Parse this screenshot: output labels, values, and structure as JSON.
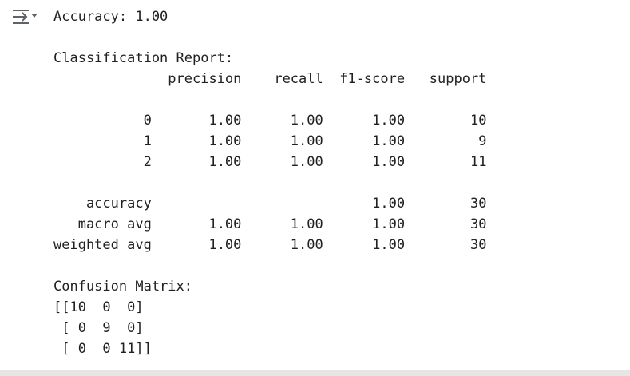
{
  "output": {
    "icon": "collapse-output-icon",
    "lines": [
      "Accuracy: 1.00",
      "",
      "Classification Report:",
      "              precision    recall  f1-score   support",
      "",
      "           0       1.00      1.00      1.00        10",
      "           1       1.00      1.00      1.00         9",
      "           2       1.00      1.00      1.00        11",
      "",
      "    accuracy                           1.00        30",
      "   macro avg       1.00      1.00      1.00        30",
      "weighted avg       1.00      1.00      1.00        30",
      "",
      "Confusion Matrix:",
      "[[10  0  0]",
      " [ 0  9  0]",
      " [ 0  0 11]]"
    ]
  }
}
